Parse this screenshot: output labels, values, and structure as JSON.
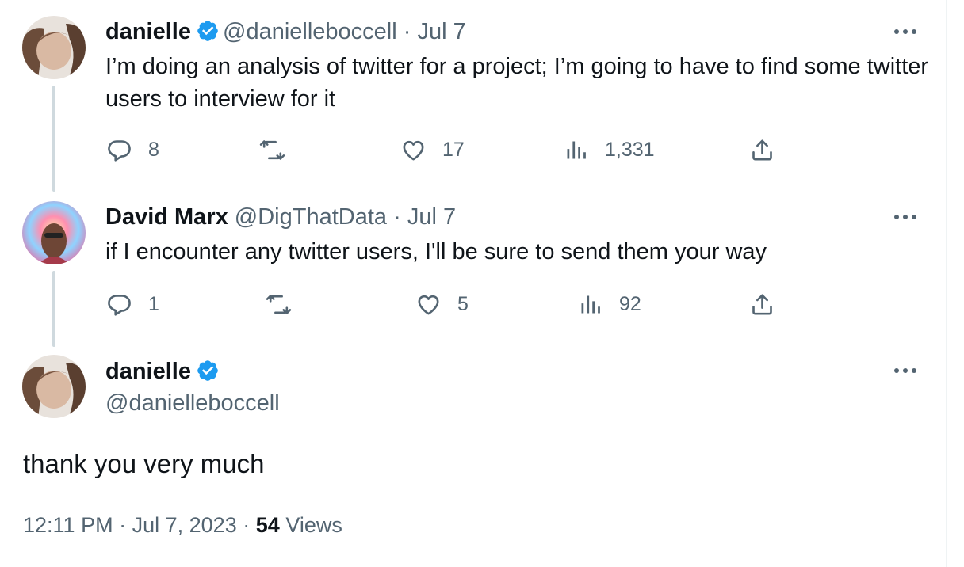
{
  "tweet1": {
    "name": "danielle",
    "handle": "@danielleboccell",
    "date": "Jul 7",
    "text": "I’m doing an analysis of twitter for a project; I’m going to have to find some twitter users to interview for it",
    "replies": "8",
    "retweets": "",
    "likes": "17",
    "views": "1,331"
  },
  "tweet2": {
    "name": "David Marx",
    "handle": "@DigThatData",
    "date": "Jul 7",
    "text": "if I encounter any twitter users, I'll be sure to send them your way",
    "replies": "1",
    "retweets": "",
    "likes": "5",
    "views": "92"
  },
  "main_tweet": {
    "name": "danielle",
    "handle": "@danielleboccell",
    "text": "thank you very much",
    "time": "12:11 PM",
    "date": "Jul 7, 2023",
    "views_count": "54",
    "views_label": "Views"
  },
  "separator": "·",
  "colors": {
    "verified": "#1d9bf0",
    "secondary": "#536471",
    "thread_line": "#cfd9de"
  }
}
